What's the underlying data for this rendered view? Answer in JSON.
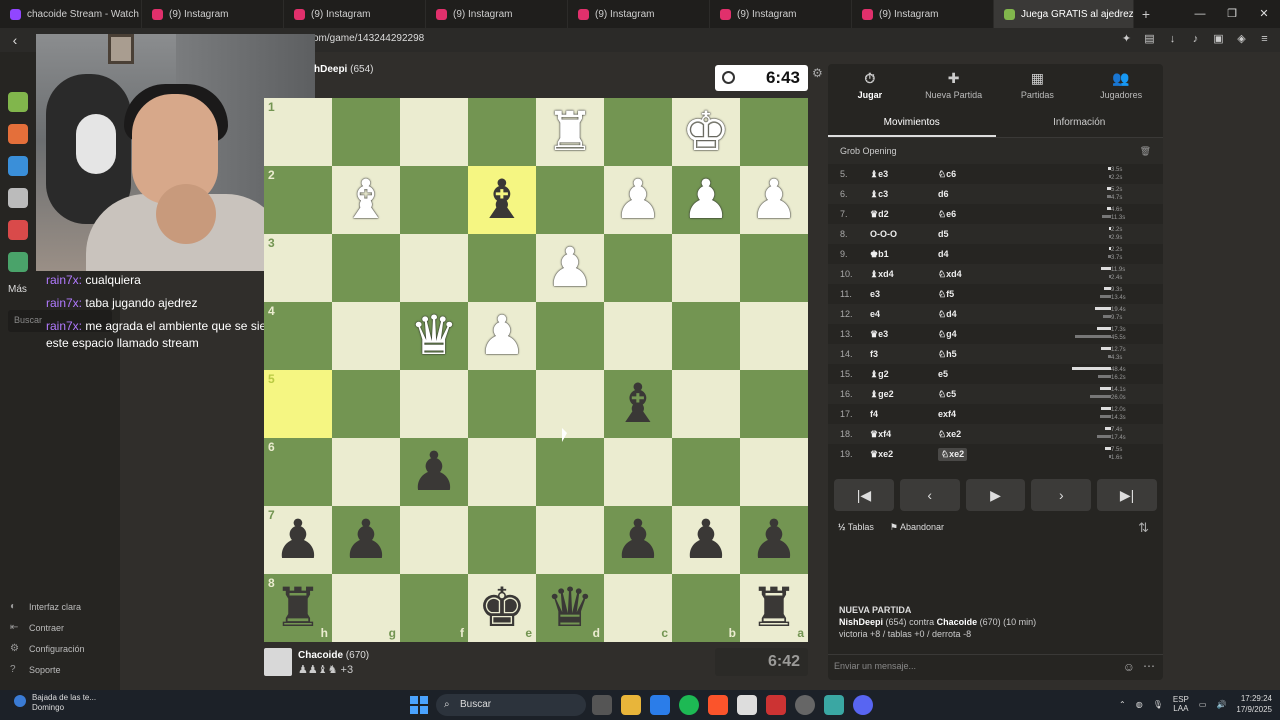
{
  "browser": {
    "tabs": [
      {
        "title": "chacoide Stream - Watch L",
        "icon_color": "#9146ff"
      },
      {
        "title": "(9) Instagram",
        "icon_color": "#e1306c"
      },
      {
        "title": "(9) Instagram",
        "icon_color": "#e1306c"
      },
      {
        "title": "(9) Instagram",
        "icon_color": "#e1306c"
      },
      {
        "title": "(9) Instagram",
        "icon_color": "#e1306c"
      },
      {
        "title": "(9) Instagram",
        "icon_color": "#e1306c"
      },
      {
        "title": "(9) Instagram",
        "icon_color": "#e1306c"
      },
      {
        "title": "Juega GRATIS al ajedrez c",
        "icon_color": "#81b64c",
        "active": true
      }
    ],
    "url": "om/game/143244292298"
  },
  "left_nav": {
    "more_label": "Más",
    "search_placeholder": "Buscar",
    "bottom_items": [
      {
        "label": "Interfaz clara",
        "icon": "sun-icon"
      },
      {
        "label": "Contraer",
        "icon": "collapse-icon"
      },
      {
        "label": "Configuración",
        "icon": "gear-icon"
      },
      {
        "label": "Soporte",
        "icon": "help-icon"
      }
    ]
  },
  "chat": [
    {
      "user": "rain7x:",
      "text": "cualquiera"
    },
    {
      "user": "rain7x:",
      "text": "taba jugando ajedrez"
    },
    {
      "user": "rain7x:",
      "text": "me agrada el ambiente que se siente en este espacio llamado stream"
    }
  ],
  "top_player": {
    "name": "hDeepi",
    "rating": "(654)"
  },
  "top_clock": "6:43",
  "bottom_player": {
    "name": "Chacoide",
    "rating": "(670)",
    "captured_extra": "+3"
  },
  "bottom_clock": "6:42",
  "board": {
    "light": "#ebecd0",
    "dark": "#739552",
    "highlight": "#f5f682",
    "ranks": [
      "1",
      "2",
      "3",
      "4",
      "5",
      "6",
      "7",
      "8"
    ],
    "files": [
      "h",
      "g",
      "f",
      "e",
      "d",
      "c",
      "b",
      "a"
    ],
    "squares": [
      [
        "",
        "",
        "",
        "",
        "R",
        "",
        "K",
        ""
      ],
      [
        "",
        "B",
        "",
        "b",
        "",
        "P",
        "P",
        "P"
      ],
      [
        "",
        "",
        "",
        "",
        "P",
        "",
        "",
        ""
      ],
      [
        "",
        "",
        "Q",
        "P",
        "",
        "",
        "",
        ""
      ],
      [
        "",
        "",
        "",
        "",
        "",
        "b",
        "",
        ""
      ],
      [
        "",
        "",
        "p",
        "",
        "",
        "",
        "",
        ""
      ],
      [
        "p",
        "p",
        "",
        "",
        "",
        "p",
        "p",
        "p"
      ],
      [
        "r",
        "",
        "",
        "k",
        "q",
        "",
        "",
        "r"
      ]
    ],
    "highlighted": [
      [
        1,
        3
      ],
      [
        4,
        0
      ]
    ]
  },
  "panel": {
    "tabs": [
      {
        "label": "Jugar",
        "icon": "stopwatch-icon",
        "active": true
      },
      {
        "label": "Nueva Partida",
        "icon": "plus-icon"
      },
      {
        "label": "Partidas",
        "icon": "board-icon"
      },
      {
        "label": "Jugadores",
        "icon": "players-icon"
      }
    ],
    "subtabs": [
      {
        "label": "Movimientos",
        "active": true
      },
      {
        "label": "Información"
      }
    ],
    "opening": "Grob Opening",
    "moves": [
      {
        "n": "5.",
        "w": "♝e3",
        "b": "♘c6",
        "tw": "3.5s",
        "tb": "2.2s"
      },
      {
        "n": "6.",
        "w": "♝c3",
        "b": "d6",
        "tw": "5.2s",
        "tb": "4.7s"
      },
      {
        "n": "7.",
        "w": "♛d2",
        "b": "♘e6",
        "tw": "4.6s",
        "tb": "11.3s"
      },
      {
        "n": "8.",
        "w": "O-O-O",
        "b": "d5",
        "tw": "2.2s",
        "tb": "2.9s"
      },
      {
        "n": "9.",
        "w": "♚b1",
        "b": "d4",
        "tw": "2.2s",
        "tb": "3.7s"
      },
      {
        "n": "10.",
        "w": "♝xd4",
        "b": "♘xd4",
        "tw": "11.9s",
        "tb": "2.4s"
      },
      {
        "n": "11.",
        "w": "e3",
        "b": "♘f5",
        "tw": "9.3s",
        "tb": "13.4s"
      },
      {
        "n": "12.",
        "w": "e4",
        "b": "♘d4",
        "tw": "19.4s",
        "tb": "9.7s"
      },
      {
        "n": "13.",
        "w": "♛e3",
        "b": "♘g4",
        "tw": "17.3s",
        "tb": "45.5s"
      },
      {
        "n": "14.",
        "w": "f3",
        "b": "♘h5",
        "tw": "12.7s",
        "tb": "4.3s"
      },
      {
        "n": "15.",
        "w": "♝g2",
        "b": "e5",
        "tw": "48.4s",
        "tb": "16.2s"
      },
      {
        "n": "16.",
        "w": "♝ge2",
        "b": "♘c5",
        "tw": "14.1s",
        "tb": "26.0s"
      },
      {
        "n": "17.",
        "w": "f4",
        "b": "exf4",
        "tw": "12.0s",
        "tb": "14.3s"
      },
      {
        "n": "18.",
        "w": "♛xf4",
        "b": "♘xe2",
        "tw": "7.4s",
        "tb": "17.4s"
      },
      {
        "n": "19.",
        "w": "♛xe2",
        "b": "♘xe2",
        "tw": "7.5s",
        "tb": "1.6s",
        "current": true
      }
    ],
    "actions": {
      "draw": "Tablas",
      "resign": "Abandonar"
    },
    "new_game": {
      "title": "NUEVA PARTIDA",
      "white": "NishDeepi",
      "white_rating": "(654)",
      "vs": "contra",
      "black": "Chacoide",
      "black_rating": "(670)",
      "time": "(10 min)",
      "result": "victoria +8 / tablas +0 / derrota -8"
    },
    "message_placeholder": "Enviar un mensaje..."
  },
  "taskbar": {
    "weather_line1": "Bajada de las te...",
    "weather_line2": "Domingo",
    "search": "Buscar",
    "lang1": "ESP",
    "lang2": "LAA",
    "time": "17:29:24",
    "date": "17/9/2025"
  }
}
